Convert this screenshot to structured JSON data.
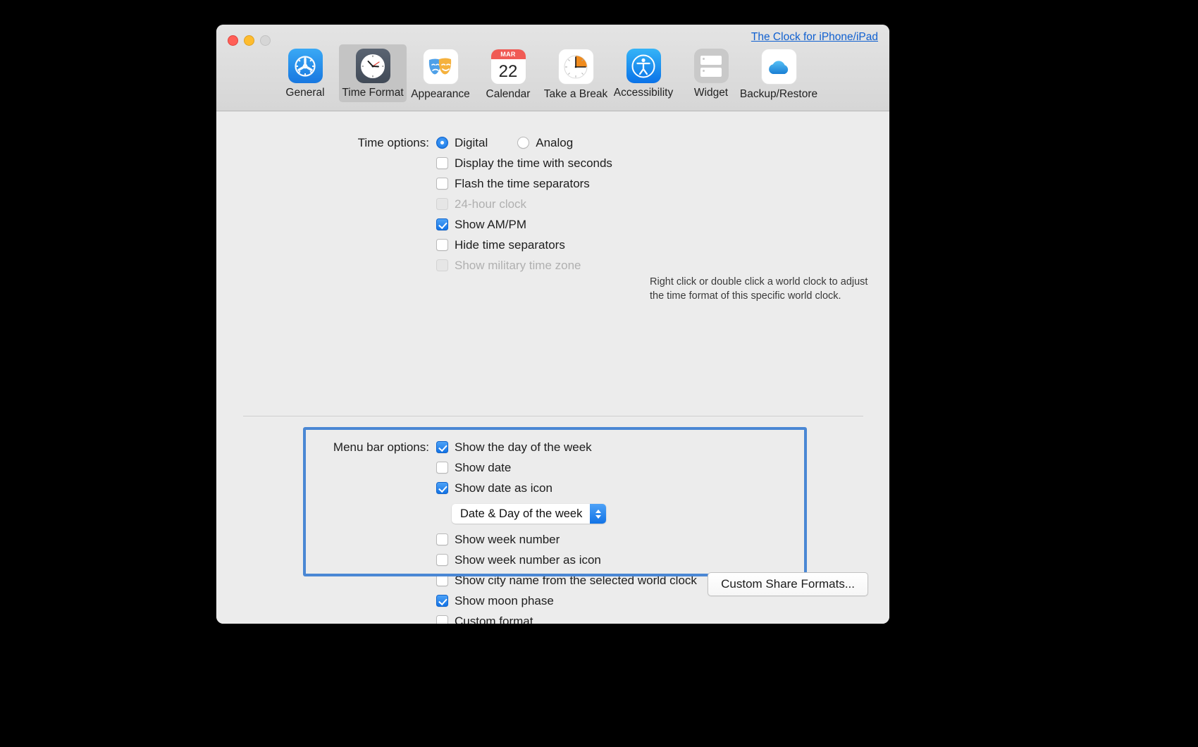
{
  "window": {
    "promo_link": "The Clock for iPhone/iPad",
    "traffic_lights": {
      "close": "close-button",
      "minimize": "minimize-button",
      "zoom": "zoom-button"
    }
  },
  "toolbar": {
    "tabs": [
      {
        "label": "General",
        "icon": "gear-icon",
        "selected": false
      },
      {
        "label": "Time Format",
        "icon": "clock-icon",
        "selected": true
      },
      {
        "label": "Appearance",
        "icon": "theater-masks-icon",
        "selected": false
      },
      {
        "label": "Calendar",
        "icon": "calendar-icon",
        "selected": false
      },
      {
        "label": "Take a Break",
        "icon": "timer-icon",
        "selected": false
      },
      {
        "label": "Accessibility",
        "icon": "accessibility-icon",
        "selected": false
      },
      {
        "label": "Widget",
        "icon": "widget-icon",
        "selected": false
      },
      {
        "label": "Backup/Restore",
        "icon": "cloud-icon",
        "selected": false
      }
    ],
    "calendar_icon": {
      "month": "MAR",
      "day": "22"
    }
  },
  "time_options": {
    "label": "Time options:",
    "radios": [
      {
        "label": "Digital",
        "selected": true
      },
      {
        "label": "Analog",
        "selected": false
      }
    ],
    "checkboxes": [
      {
        "label": "Display the time with seconds",
        "checked": false,
        "disabled": false
      },
      {
        "label": "Flash the time separators",
        "checked": false,
        "disabled": false
      },
      {
        "label": "24-hour clock",
        "checked": false,
        "disabled": true
      },
      {
        "label": "Show AM/PM",
        "checked": true,
        "disabled": false
      },
      {
        "label": "Hide time separators",
        "checked": false,
        "disabled": false
      },
      {
        "label": "Show military time zone",
        "checked": false,
        "disabled": true
      }
    ],
    "hint_line1": "Right click or double click a world clock to adjust",
    "hint_line2": "the time format of this specific world clock."
  },
  "menu_bar_options": {
    "label": "Menu bar options:",
    "checkboxes_top": [
      {
        "label": "Show the day of the week",
        "checked": true
      },
      {
        "label": "Show date",
        "checked": false
      },
      {
        "label": "Show date as icon",
        "checked": true
      }
    ],
    "date_format_popup": {
      "selected": "Date & Day of the week"
    },
    "checkboxes_mid": [
      {
        "label": "Show week number",
        "checked": false
      },
      {
        "label": "Show week number as icon",
        "checked": false
      }
    ],
    "checkboxes_bottom": [
      {
        "label": "Show city name from the selected world clock",
        "checked": false
      },
      {
        "label": "Show moon phase",
        "checked": true
      },
      {
        "label": "Custom format",
        "checked": false
      }
    ]
  },
  "footer": {
    "share_formats_button": "Custom Share Formats..."
  },
  "colors": {
    "accent_blue": "#1273e6",
    "highlight_border": "#4a87d4",
    "link_blue": "#1060d0",
    "window_bg": "#ececec",
    "toolbar_bg": "#dcdcdc",
    "selected_tab_bg": "#c4c4c4"
  }
}
